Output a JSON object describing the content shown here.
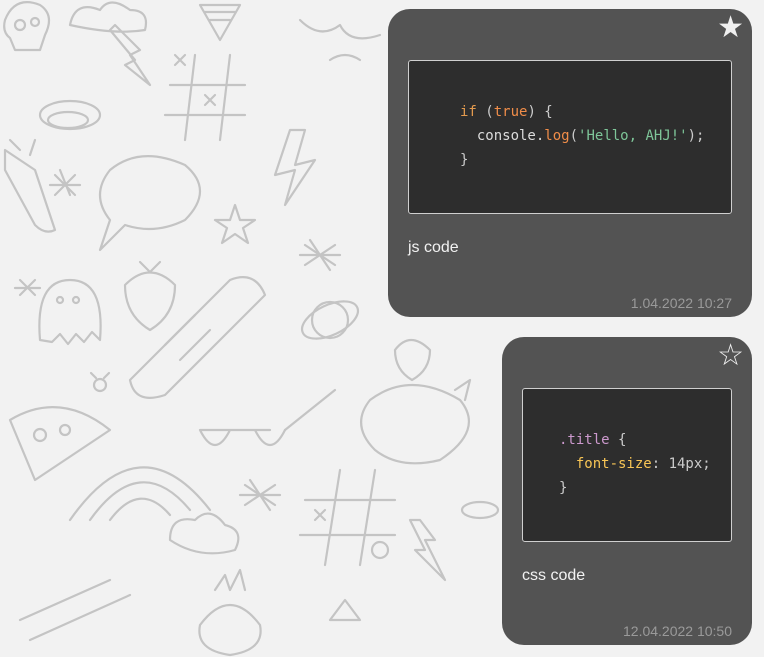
{
  "messages": [
    {
      "starred": true,
      "star_icon": "★",
      "code": {
        "language": "js",
        "line1": {
          "kw": "if",
          "p1": " (",
          "val": "true",
          "p2": ") {"
        },
        "line2": {
          "obj": "  console.",
          "fn": "log",
          "p1": "(",
          "str": "'Hello, AHJ!'",
          "p2": ");"
        },
        "line3": "}"
      },
      "text": "js code",
      "timestamp": "1.04.2022 10:27"
    },
    {
      "starred": false,
      "star_icon": "☆",
      "code": {
        "language": "css",
        "line1": {
          "sel": ".title",
          "p1": " {"
        },
        "line2": {
          "prop": "  font-size",
          "p1": ": 14px;"
        },
        "line3": "}"
      },
      "text": "css code",
      "timestamp": "12.04.2022 10:50"
    }
  ],
  "colors": {
    "card": "#535353",
    "code_bg": "#2d2d2d",
    "background": "#f2f2f2"
  }
}
